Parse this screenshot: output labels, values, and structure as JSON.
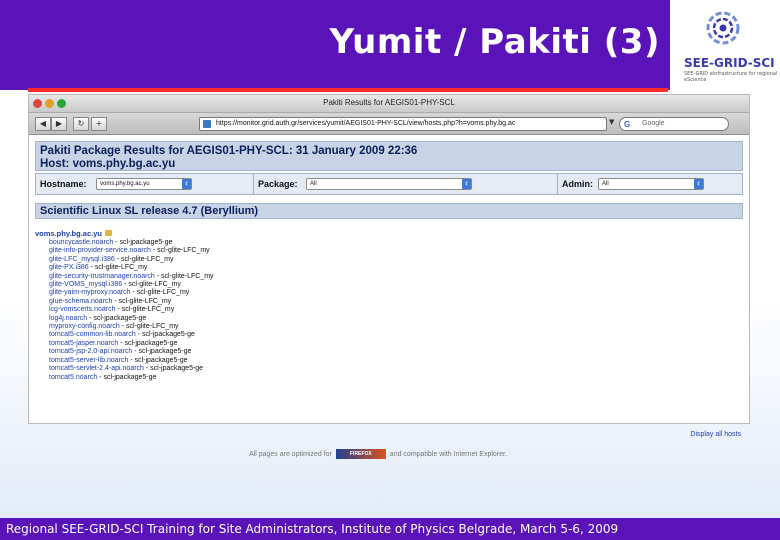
{
  "slide": {
    "title": "Yumit / Pakiti (3)",
    "footer": "Regional SEE-GRID-SCI Training for Site Administrators, Institute of Physics Belgrade, March 5-6, 2009",
    "logo_text": "SEE-GRID-SCI",
    "logo_sub": "SEE-GRID eInfrastructure for regional eScience"
  },
  "browser": {
    "window_title": "Pakiti Results for AEGIS01-PHY-SCL",
    "url": "https://monitor.grid.auth.gr/services/yumit/AEGIS01-PHY-SCL/view/hosts.php?h=voms.phy.bg.ac",
    "search_placeholder": "Google",
    "search_engine_icon": "G"
  },
  "page": {
    "header_line1": "Pakiti Package Results for AEGIS01-PHY-SCL: 31 January 2009 22:36",
    "header_line2": "Host: voms.phy.bg.ac.yu",
    "filters": {
      "hostname_label": "Hostname:",
      "hostname_value": "voms.phy.bg.ac.yu",
      "package_label": "Package:",
      "package_value": "All",
      "admin_label": "Admin:",
      "admin_value": "All"
    },
    "release": "Scientific Linux SL release 4.7 (Beryllium)",
    "host_link": "voms.phy.bg.ac.yu",
    "packages": [
      {
        "name": "bouncycastle.noarch",
        "repo": " - scl-jpackage5-ge"
      },
      {
        "name": "glite-info-provider-service.noarch",
        "repo": " - scl-glite-LFC_my"
      },
      {
        "name": "glite-LFC_mysql.i386",
        "repo": " - scl-glite-LFC_my"
      },
      {
        "name": "glite-PX.i386",
        "repo": " - scl-glite-LFC_my"
      },
      {
        "name": "glite-security-trustmanager.noarch",
        "repo": " - scl-glite-LFC_my"
      },
      {
        "name": "glite-VOMS_mysql.i386",
        "repo": " - scl-glite-LFC_my"
      },
      {
        "name": "glite-yaim-myproxy.noarch",
        "repo": " - scl-glite-LFC_my"
      },
      {
        "name": "glue-schema.noarch",
        "repo": " - scl-glite-LFC_my"
      },
      {
        "name": "lcg-vomscerts.noarch",
        "repo": " - scl-glite-LFC_my"
      },
      {
        "name": "log4j.noarch",
        "repo": " - scl-jpackage5-ge"
      },
      {
        "name": "myproxy-config.noarch",
        "repo": " - scl-glite-LFC_my"
      },
      {
        "name": "tomcat5-common-lib.noarch",
        "repo": " - scl-jpackage5-ge"
      },
      {
        "name": "tomcat5-jasper.noarch",
        "repo": " - scl-jpackage5-ge"
      },
      {
        "name": "tomcat5-jsp-2.0-api.noarch",
        "repo": " - scl-jpackage5-ge"
      },
      {
        "name": "tomcat5-server-lib.noarch",
        "repo": " - scl-jpackage5-ge"
      },
      {
        "name": "tomcat5-servlet-2.4-api.noarch",
        "repo": " - scl-jpackage5-ge"
      },
      {
        "name": "tomcat5.noarch",
        "repo": " - scl-jpackage5-ge"
      }
    ],
    "display_all": "Display all hosts",
    "optimized_pre": "All pages are optimized for",
    "optimized_badge": "FIREFOX",
    "optimized_post": "and compatible with Internet Explorer."
  },
  "colors": {
    "slide_purple": "#5a13b9",
    "accent_red": "#ff2a2a",
    "link_blue": "#1a3fb5",
    "header_navy": "#0a1f5c"
  }
}
